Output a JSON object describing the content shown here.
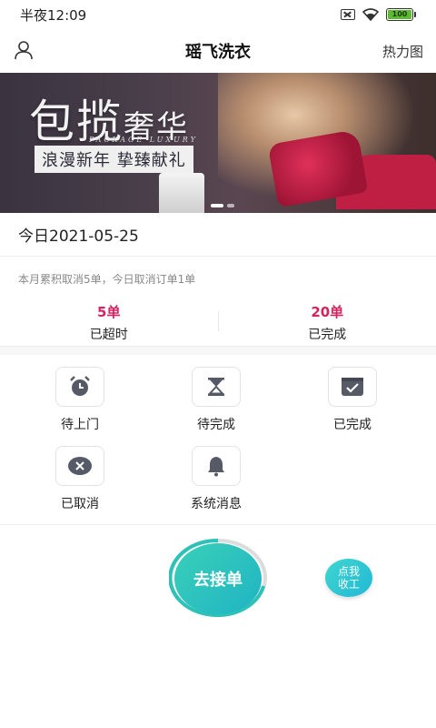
{
  "status_bar": {
    "time": "半夜12:09",
    "battery": "100"
  },
  "header": {
    "title": "瑶飞洗衣",
    "heatmap_label": "热力图"
  },
  "banner": {
    "headline_big": "包揽",
    "headline_small": "奢华",
    "subtitle_en": "PACKAGE LUXURY",
    "slogan": "浪漫新年  挚臻献礼"
  },
  "date": "今日2021-05-25",
  "summary": "本月累积取消5单，今日取消订单1单",
  "stats": [
    {
      "count": "5单",
      "label": "已超时"
    },
    {
      "count": "20单",
      "label": "已完成"
    }
  ],
  "grid": [
    {
      "label": "待上门",
      "icon": "alarm-clock-icon"
    },
    {
      "label": "待完成",
      "icon": "hourglass-icon"
    },
    {
      "label": "已完成",
      "icon": "calendar-check-icon"
    },
    {
      "label": "已取消",
      "icon": "cancel-circle-icon"
    },
    {
      "label": "系统消息",
      "icon": "bell-icon"
    }
  ],
  "actions": {
    "take_order": "去接单",
    "clock_off_line1": "点我",
    "clock_off_line2": "收工"
  },
  "colors": {
    "accent_red": "#d6235e",
    "teal": "#1fb4c4",
    "icon_dark": "#555a66"
  }
}
